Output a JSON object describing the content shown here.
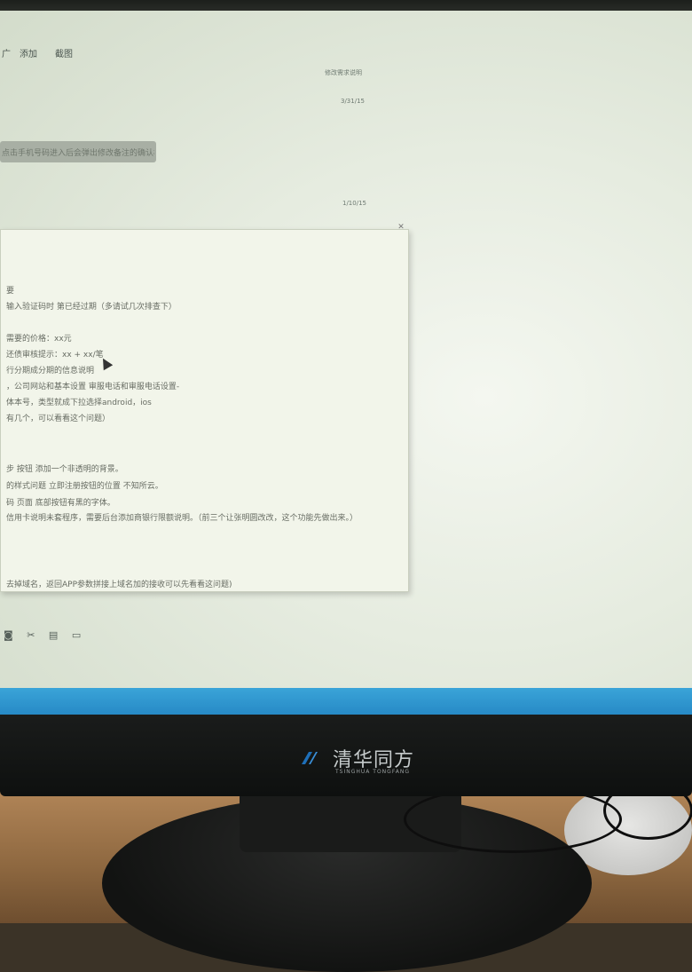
{
  "screen": {
    "menu": [
      "广",
      "添加",
      "截图"
    ],
    "header_lines": [
      "修改需求说明",
      "3/31/15"
    ],
    "timestamp": "1/10/15",
    "selected_text": "点击手机号码进入后会弹出修改备注的确认框"
  },
  "popup": {
    "close_label": "关闭",
    "lines": [
      "要",
      "输入验证码时 第已经过期（多请试几次排查下）",
      "",
      "需要的价格：xx元",
      "还债审核提示：xx + xx/笔",
      "行分期成分期的信息说明",
      "，公司网站和基本设置 审服电话和审服电话设置-",
      "体本号，类型就成下拉选择android，ios",
      "有几个，可以看看这个问题）",
      "",
      "",
      "步 按钮 添加一个非透明的背景。",
      "的样式问题 立即注册按钮的位置 不知所云。",
      "码 页面 底部按钮有黑的字体。",
      "信用卡说明未套程序，需要后台添加商银行限额说明。（前三个让张明圆改改，这个功能先做出来。）",
      "",
      "",
      "",
      "去掉域名，返回APP参数拼接上域名加的接收可以先看看这问题)"
    ]
  },
  "toolbar": {
    "icons": [
      "camera-icon",
      "scissors-icon",
      "document-icon",
      "chat-icon"
    ]
  },
  "monitor": {
    "brand": "清华同方",
    "brand_sub": "TSINGHUA TONGFANG"
  },
  "colors": {
    "screen_bg": "#e6ece0",
    "taskbar": "#2b92cf",
    "bezel": "#141615",
    "desk": "#a47a4e"
  }
}
